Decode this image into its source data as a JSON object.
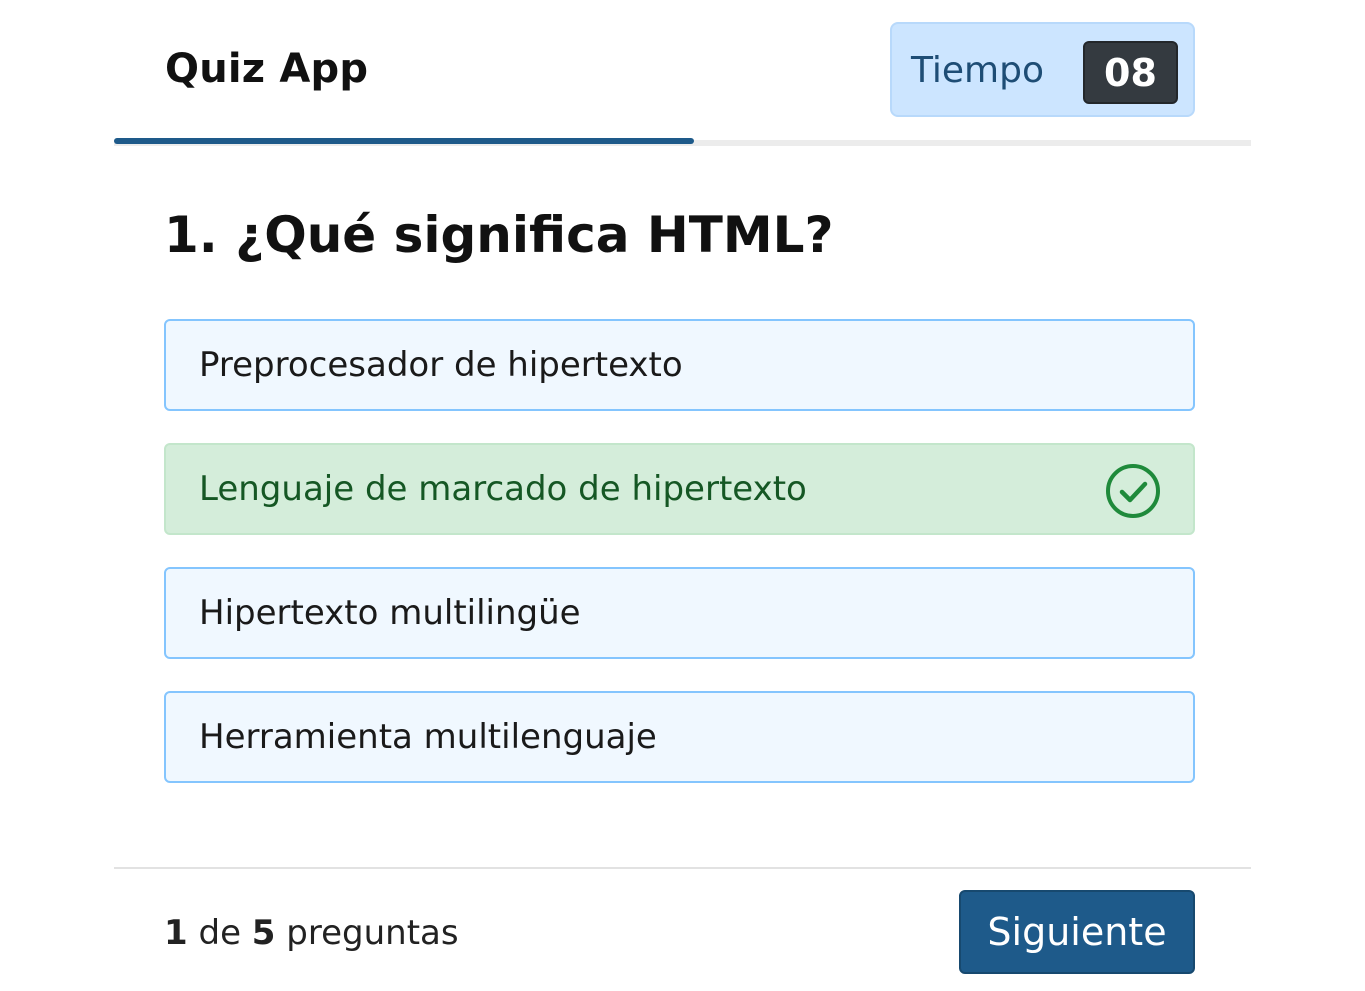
{
  "header": {
    "title": "Quiz App",
    "timer_label": "Tiempo",
    "timer_value": "08",
    "time_progress": 0.51
  },
  "question": {
    "text": "1. ¿Qué significa HTML?"
  },
  "options": [
    {
      "label": "Preprocesador de hipertexto",
      "state": "default"
    },
    {
      "label": "Lenguaje de marcado de hipertexto",
      "state": "correct"
    },
    {
      "label": "Hipertexto multilingüe",
      "state": "default"
    },
    {
      "label": "Herramienta multilenguaje",
      "state": "default"
    }
  ],
  "footer": {
    "current": "1",
    "of": "de",
    "total": "5",
    "suffix": "preguntas",
    "next_label": "Siguiente"
  },
  "colors": {
    "accent": "#1e5a8a",
    "correct_bg": "#d4edda",
    "correct_text": "#155724",
    "option_bg": "#f0f8ff",
    "option_border": "#84c5fe",
    "timer_bg": "#cce5ff"
  },
  "icons": {
    "correct_option": "check-circle-icon"
  }
}
